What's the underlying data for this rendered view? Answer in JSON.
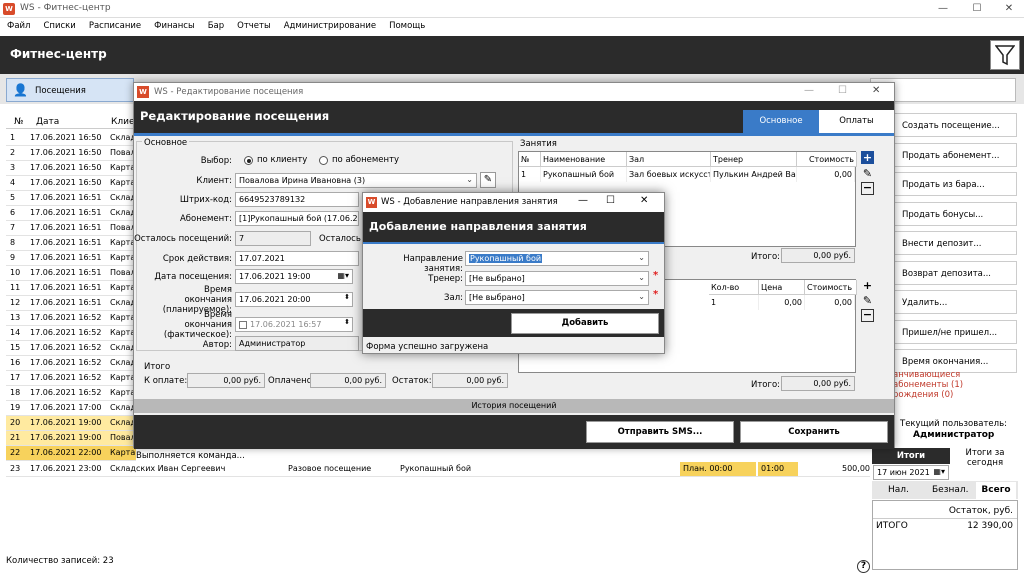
{
  "app": {
    "icon": "W",
    "title": "WS - Фитнес-центр",
    "header": "Фитнес-центр"
  },
  "menu": [
    "Файл",
    "Списки",
    "Расписание",
    "Финансы",
    "Бар",
    "Отчеты",
    "Администрирование",
    "Помощь"
  ],
  "toolbar": {
    "visits_label": "Посещения"
  },
  "table": {
    "col_no": "№",
    "col_date": "Дата",
    "col_client": "Клиен",
    "rows": [
      {
        "no": "1",
        "date": "17.06.2021 16:50",
        "client": "Склад"
      },
      {
        "no": "2",
        "date": "17.06.2021 16:50",
        "client": "Повал"
      },
      {
        "no": "3",
        "date": "17.06.2021 16:50",
        "client": "Карта"
      },
      {
        "no": "4",
        "date": "17.06.2021 16:50",
        "client": "Карта"
      },
      {
        "no": "5",
        "date": "17.06.2021 16:51",
        "client": "Склад"
      },
      {
        "no": "6",
        "date": "17.06.2021 16:51",
        "client": "Склад"
      },
      {
        "no": "7",
        "date": "17.06.2021 16:51",
        "client": "Повал"
      },
      {
        "no": "8",
        "date": "17.06.2021 16:51",
        "client": "Карта"
      },
      {
        "no": "9",
        "date": "17.06.2021 16:51",
        "client": "Карта"
      },
      {
        "no": "10",
        "date": "17.06.2021 16:51",
        "client": "Повал"
      },
      {
        "no": "11",
        "date": "17.06.2021 16:51",
        "client": "Карта"
      },
      {
        "no": "12",
        "date": "17.06.2021 16:51",
        "client": "Склад"
      },
      {
        "no": "13",
        "date": "17.06.2021 16:52",
        "client": "Карта"
      },
      {
        "no": "14",
        "date": "17.06.2021 16:52",
        "client": "Карта"
      },
      {
        "no": "15",
        "date": "17.06.2021 16:52",
        "client": "Склад"
      },
      {
        "no": "16",
        "date": "17.06.2021 16:52",
        "client": "Склад"
      },
      {
        "no": "17",
        "date": "17.06.2021 16:52",
        "client": "Карта"
      },
      {
        "no": "18",
        "date": "17.06.2021 16:52",
        "client": "Карта"
      },
      {
        "no": "19",
        "date": "17.06.2021 17:00",
        "client": "Склад"
      },
      {
        "no": "20",
        "date": "17.06.2021 19:00",
        "client": "Склад"
      },
      {
        "no": "21",
        "date": "17.06.2021 19:00",
        "client": "Повал"
      },
      {
        "no": "22",
        "date": "17.06.2021 22:00",
        "client": "Карта"
      }
    ],
    "row23": {
      "no": "23",
      "date": "17.06.2021 23:00",
      "client": "Складских Иван Сергеевич",
      "type": "Разовое посещение",
      "activity": "Рукопашный бой",
      "plan": "План. 00:00",
      "time": "01:00",
      "amount": "500,00"
    }
  },
  "footer": {
    "count": "Количество записей: 23",
    "help": "?"
  },
  "right_panel": {
    "buttons": [
      "Создать посещение...",
      "Продать абонемент...",
      "Продать из бара...",
      "Продать бонусы...",
      "Внести депозит...",
      "Возврат депозита...",
      "Удалить...",
      "Пришел/не пришел...",
      "Время окончания..."
    ],
    "red1": "анчивающиеся абонементы (1)",
    "red2": "рождения (0)",
    "user_label": "Текущий пользователь:",
    "user": "Администратор",
    "tab_totals": "Итоги",
    "tab_today": "Итоги за сегодня",
    "date": "17 июн 2021",
    "sub_cash": "Нал.",
    "sub_card": "Безнал.",
    "sub_all": "Всего",
    "col_balance": "Остаток, руб.",
    "total_label": "ИТОГО",
    "total_value": "12 390,00"
  },
  "edit_dialog": {
    "icon": "W",
    "title": "WS - Редактирование посещения",
    "header": "Редактирование посещения",
    "tab_main": "Основное",
    "tab_payments": "Оплаты",
    "section_main": "Основное",
    "choice_label": "Выбор:",
    "by_client": "по клиенту",
    "by_subscription": "по абонементу",
    "client_label": "Клиент:",
    "client": "Повалова Ирина Ивановна (3)",
    "barcode_label": "Штрих-код:",
    "barcode": "66495237891З2",
    "subscription_label": "Абонемент:",
    "subscription": "[1]Рукопашный бой (17.06.21)",
    "visits_left_label": "Осталось посещений:",
    "visits_left": "7",
    "visits_left2": "Осталось ч",
    "valid_label": "Срок действия:",
    "valid": "17.07.2021",
    "visit_date_label": "Дата посещения:",
    "visit_date": "17.06.2021 19:00",
    "end_planned_label1": "Время окончания",
    "end_planned_label2": "(планируемое):",
    "end_planned": "17.06.2021 20:00",
    "end_actual_label1": "Время окончания",
    "end_actual_label2": "(фактическое):",
    "end_actual": "17.06.2021 16:57",
    "author_label": "Автор:",
    "author": "Администратор",
    "totals_label": "Итого",
    "to_pay_label": "К оплате:",
    "to_pay": "0,00 руб.",
    "paid_label": "Оплачено:",
    "paid": "0,00 руб.",
    "remain_label": "Остаток:",
    "remain": "0,00 руб.",
    "classes_label": "Занятия",
    "classes_cols": [
      "№",
      "Наименование",
      "Зал",
      "Тренер",
      "Стоимость"
    ],
    "classes_row": [
      "1",
      "Рукопашный бой",
      "Зал боевых искусств",
      "Пулькин Андрей Вал",
      "0,00"
    ],
    "classes_total_label": "Итого:",
    "classes_total": "0,00 руб.",
    "goods_cols": [
      "Кол-во",
      "Цена",
      "Стоимость"
    ],
    "goods_row": [
      "1",
      "0,00",
      "0,00"
    ],
    "goods_total_label": "Итого:",
    "goods_total": "0,00 руб.",
    "history": "История посещений",
    "send_sms": "Отправить SMS...",
    "save": "Сохранить",
    "status": "Выполняется команда..."
  },
  "add_dialog": {
    "icon": "W",
    "title": "WS - Добавление направления занятия",
    "header": "Добавление направления занятия",
    "direction_label": "Направление занятия:",
    "direction": "Рукопашный бой",
    "trainer_label": "Тренер:",
    "trainer": "[Не выбрано]",
    "hall_label": "Зал:",
    "hall": "[Не выбрано]",
    "add": "Добавить",
    "status": "Форма успешно загружена"
  },
  "colors": {
    "accent": "#3a7bc8",
    "dark": "#2b2b2b",
    "highlight": "#ffeaa0",
    "highlight_dark": "#f7d25c",
    "required": "#e02020"
  }
}
